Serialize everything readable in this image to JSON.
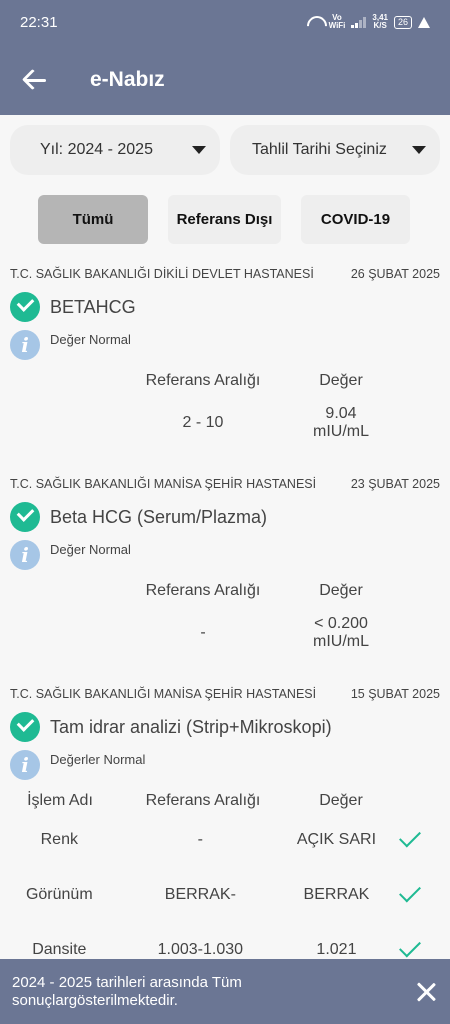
{
  "status_bar": {
    "time": "22:31",
    "vowifi_top": "Vo",
    "vowifi_bottom": "WiFi",
    "speed_value": "3,41",
    "speed_unit": "K/S",
    "battery": "26"
  },
  "app_bar": {
    "title": "e-Nabız"
  },
  "filters": {
    "year_select": "Yıl: 2024 - 2025",
    "date_select": "Tahlil Tarihi Seçiniz"
  },
  "tabs": [
    {
      "label": "Tümü",
      "active": true
    },
    {
      "label": "Referans Dışı",
      "active": false
    },
    {
      "label": "COVID-19",
      "active": false
    }
  ],
  "results": [
    {
      "hospital": "T.C. SAĞLIK BAKANLIĞI DİKİLİ DEVLET HASTANESİ",
      "date": "26 ŞUBAT 2025",
      "test_name": "BETAHCG",
      "status_note": "Değer Normal",
      "header_ref": "Referans Aralığı",
      "header_value": "Değer",
      "ref_range": "2 - 10",
      "value": "9.04 mIU/mL"
    },
    {
      "hospital": "T.C. SAĞLIK BAKANLIĞI MANİSA ŞEHİR HASTANESİ",
      "date": "23 ŞUBAT 2025",
      "test_name": "Beta HCG (Serum/Plazma)",
      "status_note": "Değer Normal",
      "header_ref": "Referans Aralığı",
      "header_value": "Değer",
      "ref_range": "-",
      "value": "< 0.200 mIU/mL"
    },
    {
      "hospital": "T.C. SAĞLIK BAKANLIĞI MANİSA ŞEHİR HASTANESİ",
      "date": "15 ŞUBAT 2025",
      "test_name": "Tam idrar analizi (Strip+Mikroskopi)",
      "status_note": "Değerler Normal",
      "header_name": "İşlem Adı",
      "header_ref": "Referans Aralığı",
      "header_value": "Değer",
      "rows": [
        {
          "name": "Renk",
          "ref": "-",
          "value": "AÇIK SARI"
        },
        {
          "name": "Görünüm",
          "ref": "BERRAK-",
          "value": "BERRAK"
        },
        {
          "name": "Dansite",
          "ref": "1.003-1.030",
          "value": "1.021"
        }
      ]
    }
  ],
  "snackbar": {
    "message": "2024 - 2025 tarihleri arasında Tüm sonuçlargösterilmektedir."
  },
  "colors": {
    "primary": "#6b7694",
    "success": "#1fba93",
    "info": "#a6c6e6",
    "chip_active": "#b5b5b5",
    "chip": "#eeeeee"
  }
}
